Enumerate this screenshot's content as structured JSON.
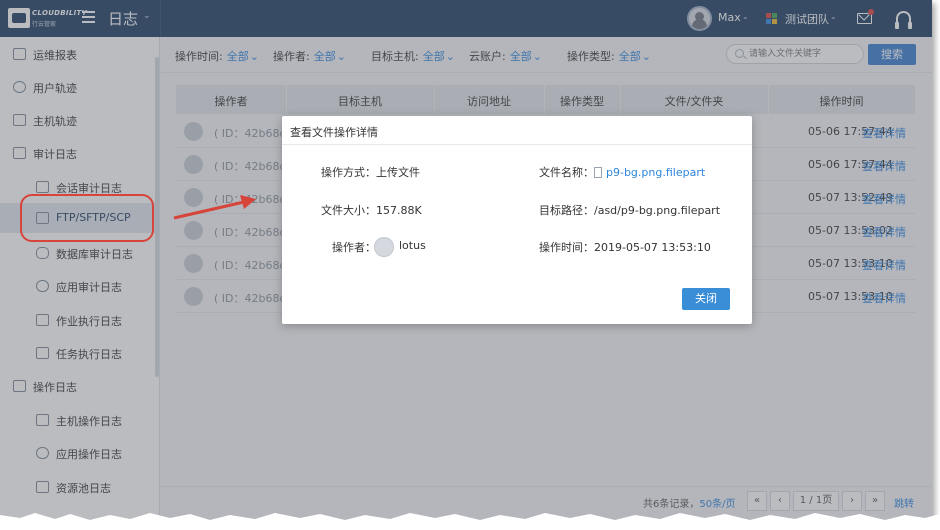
{
  "header": {
    "logo_text": "CLOUDBILITY",
    "logo_sub": "行云管家",
    "module_title": "日志",
    "user_name": "Max",
    "team_name": "测试团队",
    "icons": [
      "menu-icon",
      "avatar",
      "team-icon",
      "mail-icon",
      "headset-icon"
    ]
  },
  "sidebar": {
    "items": [
      {
        "label": "运维报表",
        "level": "top",
        "icon": "report-icon"
      },
      {
        "label": "用户轨迹",
        "level": "top",
        "icon": "user-track-icon"
      },
      {
        "label": "主机轨迹",
        "level": "top",
        "icon": "host-track-icon"
      },
      {
        "label": "审计日志",
        "level": "top",
        "icon": "audit-icon"
      },
      {
        "label": "会话审计日志",
        "level": "sub",
        "icon": "monitor-icon"
      },
      {
        "label": "FTP/SFTP/SCP",
        "level": "sub",
        "icon": "ftp-icon",
        "active": true
      },
      {
        "label": "数据库审计日志",
        "level": "sub",
        "icon": "database-icon"
      },
      {
        "label": "应用审计日志",
        "level": "sub",
        "icon": "cloud-icon"
      },
      {
        "label": "作业执行日志",
        "level": "sub",
        "icon": "clipboard-icon"
      },
      {
        "label": "任务执行日志",
        "level": "sub",
        "icon": "task-icon"
      },
      {
        "label": "操作日志",
        "level": "top",
        "icon": "oplog-icon"
      },
      {
        "label": "主机操作日志",
        "level": "sub",
        "icon": "monitor-icon"
      },
      {
        "label": "应用操作日志",
        "level": "sub",
        "icon": "cloud-icon"
      },
      {
        "label": "资源池日志",
        "level": "sub",
        "icon": "layers-icon"
      }
    ]
  },
  "filters": {
    "op_time_label": "操作时间:",
    "op_time_value": "全部",
    "operator_label": "操作者:",
    "operator_value": "全部",
    "host_label": "目标主机:",
    "host_value": "全部",
    "cloud_label": "云账户:",
    "cloud_value": "全部",
    "type_label": "操作类型:",
    "type_value": "全部",
    "search_placeholder": "请输入文件关键字",
    "search_button": "搜索"
  },
  "table": {
    "columns": [
      "操作者",
      "目标主机",
      "访问地址",
      "操作类型",
      "文件/文件夹",
      "操作时间"
    ],
    "rows": [
      {
        "id": "( ID：42b68d",
        "time": "05-06 17:57:44",
        "link": "查看详情"
      },
      {
        "id": "( ID：42b68d",
        "time": "05-06 17:57:44",
        "link": "查看详情"
      },
      {
        "id": "( ID：42b68d",
        "time": "05-07 13:52:49",
        "link": "查看详情"
      },
      {
        "id": "( ID：42b68d",
        "time": "05-07 13:53:02",
        "link": "查看详情"
      },
      {
        "id": "( ID：42b68d",
        "time": "05-07 13:53:10",
        "link": "查看详情"
      },
      {
        "id": "( ID：42b68d",
        "time": "05-07 13:53:10",
        "link": "查看详情"
      }
    ]
  },
  "pagination": {
    "total_prefix": "共6条记录，",
    "per_page": "50条/页",
    "first": "«",
    "prev": "‹",
    "page": "1 / 1页",
    "next": "›",
    "last": "»",
    "jump": "跳转"
  },
  "dialog": {
    "title": "查看文件操作详情",
    "method_label": "操作方式：",
    "method_value": "上传文件",
    "filename_label": "文件名称：",
    "filename_value": "p9-bg.png.filepart",
    "size_label": "文件大小：",
    "size_value": "157.88K",
    "path_label": "目标路径：",
    "path_value": "/asd/p9-bg.png.filepart",
    "operator_label": "操作者：",
    "operator_value": "lotus",
    "optime_label": "操作时间：",
    "optime_value": "2019-05-07 13:53:10",
    "close_button": "关闭"
  },
  "colors": {
    "header_bg": "#1f3d63",
    "accent": "#2e86de",
    "annotation_red": "#d6443a"
  }
}
